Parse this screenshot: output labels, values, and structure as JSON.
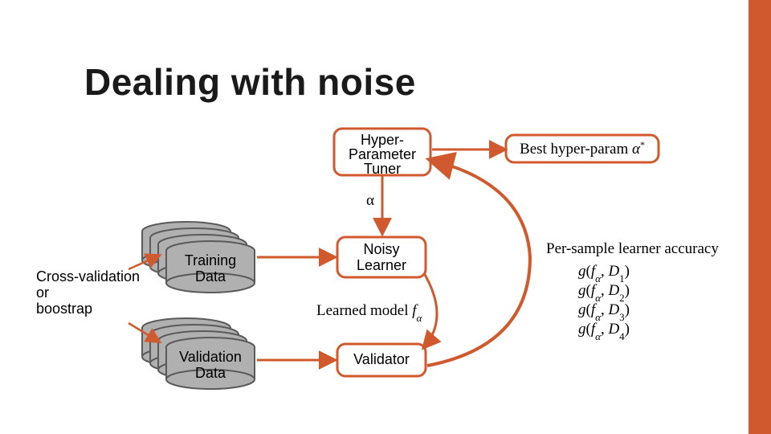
{
  "title": "Dealing with noise",
  "boxes": {
    "hyper1": "Hyper-",
    "hyper2": "Parameter",
    "hyper3": "Tuner",
    "best_prefix": "Best hyper-param ",
    "train1": "Training",
    "train2": "Data",
    "val1": "Validation",
    "val2": "Data",
    "noisy1": "Noisy",
    "noisy2": "Learner",
    "validator": "Validator"
  },
  "labels": {
    "alpha": "α",
    "cv1": "Cross-validation",
    "cv2": "or",
    "cv3": "boostrap",
    "learned_prefix": "Learned model ",
    "per_sample": "Per-sample learner accuracy"
  },
  "accuracy_lines": [
    "g(f_α, D_1)",
    "g(f_α, D_2)",
    "g(f_α, D_3)",
    "g(f_α, D_4)"
  ],
  "colors": {
    "accent": "#d05a2e",
    "cylinder_fill": "#b0b0b0",
    "cylinder_stroke": "#5a5a5a"
  }
}
